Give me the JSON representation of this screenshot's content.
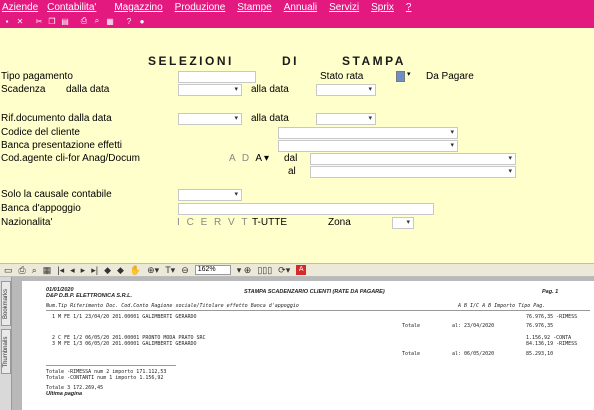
{
  "menu": [
    "Aziende",
    "Contabilita'",
    "Magazzino",
    "Produzione",
    "Stampe",
    "Annuali",
    "Servizi",
    "Sprix",
    "?"
  ],
  "toolbar_icons": [
    "save-icon",
    "close-icon",
    "cut-icon",
    "copy-icon",
    "paste-icon",
    "print-icon",
    "find-icon",
    "calendar-icon",
    "help-icon",
    "run-icon"
  ],
  "form": {
    "title_words": [
      "SELEZIONI",
      "DI",
      "STAMPA"
    ],
    "tipo_pagamento_label": "Tipo pagamento",
    "tipo_pagamento_value": "",
    "stato_rata_label": "Stato rata",
    "stato_rata_value": "Da Pagare",
    "scadenza_label": "Scadenza",
    "dalla_data_label": "dalla data",
    "alla_data_label": "alla data",
    "scadenza_dal": "",
    "scadenza_al": "",
    "rif_doc_label": "Rif.documento dalla data",
    "rif_alla_data_label": "alla data",
    "rif_dal": "",
    "rif_al": "",
    "codice_cliente_label": "Codice del cliente",
    "codice_cliente_value": "",
    "banca_effetti_label": "Banca presentazione effetti",
    "banca_effetti_value": "",
    "cod_agente_label": "Cod.agente cli-for Anag/Docum",
    "agente_letters": [
      "A",
      "D",
      "A"
    ],
    "agente_dal_label": "dal",
    "agente_al_label": "al",
    "causale_label": "Solo la causale contabile",
    "causale_value": "",
    "banca_appoggio_label": "Banca d'appoggio",
    "banca_appoggio_value": "",
    "nazionalita_label": "Nazionalita'",
    "naz_letters": [
      "I",
      "C",
      "E",
      "R",
      "V",
      "T"
    ],
    "naz_value": "T-UTTE",
    "zona_label": "Zona",
    "zona_value": ""
  },
  "viewer": {
    "zoom": "162%",
    "tabs": [
      "Bookmarks",
      "Thumbnails"
    ]
  },
  "report": {
    "date": "01/01/2020",
    "company": "D&P D.B.P. ELETTRONICA S.R.L.",
    "title": "STAMPA SCADENZARIO CLIENTI (RATE DA PAGARE)",
    "page": "Pag.  1",
    "header": "Num.Tip Riferimento Doc.   Cod.Conto Ragione sociale/Titolare effetto  Banca d'appoggio",
    "header_right": "A B I/C A B      Importo Tipo Pag.",
    "rows": [
      "1 M FE 1/1     23/04/20 201.00001 GALIMBERTI GERARDO",
      "2 C FE 1/2     06/05/20 201.00001 PRONTO MODA PRATO SRC",
      "3 M FE 1/3     06/05/20 201.00001 GALIMBERTI GERARDO"
    ],
    "row_amounts": [
      "76.976,35 -RIMESS",
      "1.156,92 -CONTA",
      "84.136,19 -RIMESS"
    ],
    "totals": [
      {
        "label": "Totale",
        "date": "al: 23/04/2020",
        "amount": "76.976,35"
      },
      {
        "label": "Totale",
        "date": "al: 06/05/2020",
        "amount": "85.293,10"
      }
    ],
    "summary": [
      "Totale -RIMESSA       num    2 importo    171.112,53",
      "Totale -CONTANTI      num    1 importo      1.156,92",
      "Totale                       3            172.269,45"
    ],
    "last_page": "Ultima pagina"
  },
  "colors": {
    "menu_bg": "#e3197f",
    "form_bg": "#ffffcc",
    "select_box": "#6d8fc9"
  }
}
